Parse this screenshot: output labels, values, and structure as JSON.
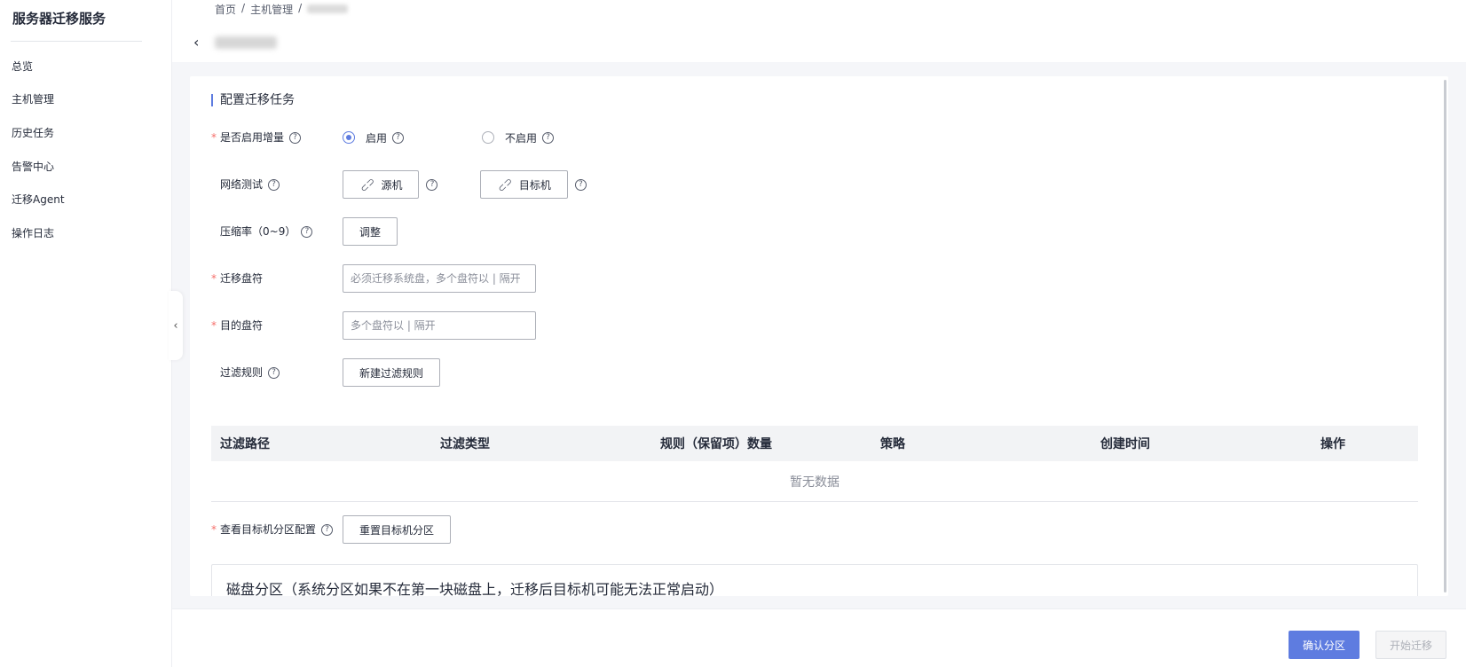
{
  "app": {
    "title": "服务器迁移服务"
  },
  "sidebar": {
    "items": [
      {
        "label": "总览"
      },
      {
        "label": "主机管理"
      },
      {
        "label": "历史任务"
      },
      {
        "label": "告警中心"
      },
      {
        "label": "迁移Agent"
      },
      {
        "label": "操作日志"
      }
    ]
  },
  "breadcrumb": {
    "home": "首页",
    "sep1": "/",
    "hosts": "主机管理",
    "sep2": "/"
  },
  "section": {
    "title": "配置迁移任务"
  },
  "form": {
    "incremental": {
      "label": "是否启用增量",
      "enable": "启用",
      "disable": "不启用",
      "selected": "启用"
    },
    "network": {
      "label": "网络测试",
      "source_btn": "源机",
      "target_btn": "目标机"
    },
    "compression": {
      "label": "压缩率（0~9）",
      "adjust_btn": "调整"
    },
    "migrate_drive": {
      "label": "迁移盘符",
      "placeholder": "必须迁移系统盘，多个盘符以 | 隔开"
    },
    "target_drive": {
      "label": "目的盘符",
      "placeholder": "多个盘符以 | 隔开"
    },
    "filter": {
      "label": "过滤规则",
      "new_btn": "新建过滤规则"
    },
    "partition": {
      "label": "查看目标机分区配置",
      "reset_btn": "重置目标机分区"
    }
  },
  "table": {
    "headers": [
      "过滤路径",
      "过滤类型",
      "规则（保留项）数量",
      "策略",
      "创建时间",
      "操作"
    ],
    "empty": "暂无数据"
  },
  "panel": {
    "title": "磁盘分区（系统分区如果不在第一块磁盘上，迁移后目标机可能无法正常启动）"
  },
  "footer": {
    "confirm": "确认分区",
    "start": "开始迁移"
  },
  "colors": {
    "accent": "#5e7ce0",
    "required": "#f66f6a"
  }
}
